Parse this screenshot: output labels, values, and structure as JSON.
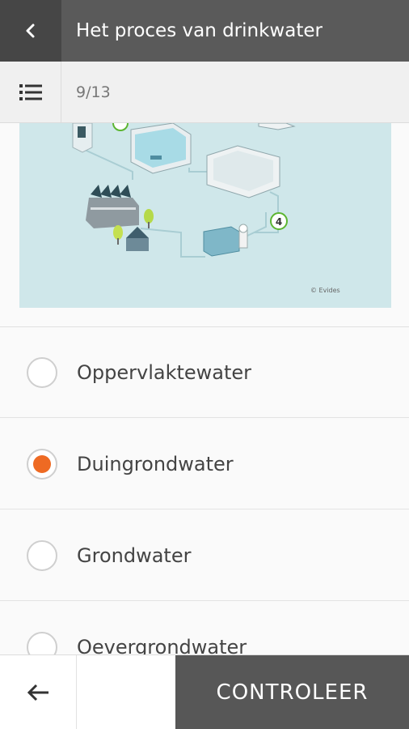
{
  "header": {
    "title": "Het proces van drinkwater",
    "back_icon": "chevron-left-icon"
  },
  "subheader": {
    "progress": "9/13",
    "list_icon": "list-icon"
  },
  "image": {
    "step_number": "4",
    "credit": "© Evides",
    "colors": {
      "water": "#bfe4ec",
      "background": "#cfe7ea",
      "step_badge": "#5cb531"
    }
  },
  "options": [
    {
      "label": "Oppervlaktewater",
      "selected": false
    },
    {
      "label": "Duingrondwater",
      "selected": true
    },
    {
      "label": "Grondwater",
      "selected": false
    },
    {
      "label": "Oevergrondwater",
      "selected": false
    }
  ],
  "footer": {
    "prev_icon": "arrow-left-icon",
    "check_label": "CONTROLEER"
  },
  "colors": {
    "accent": "#ee6a23",
    "header": "#5a5a5a",
    "button": "#575757"
  }
}
